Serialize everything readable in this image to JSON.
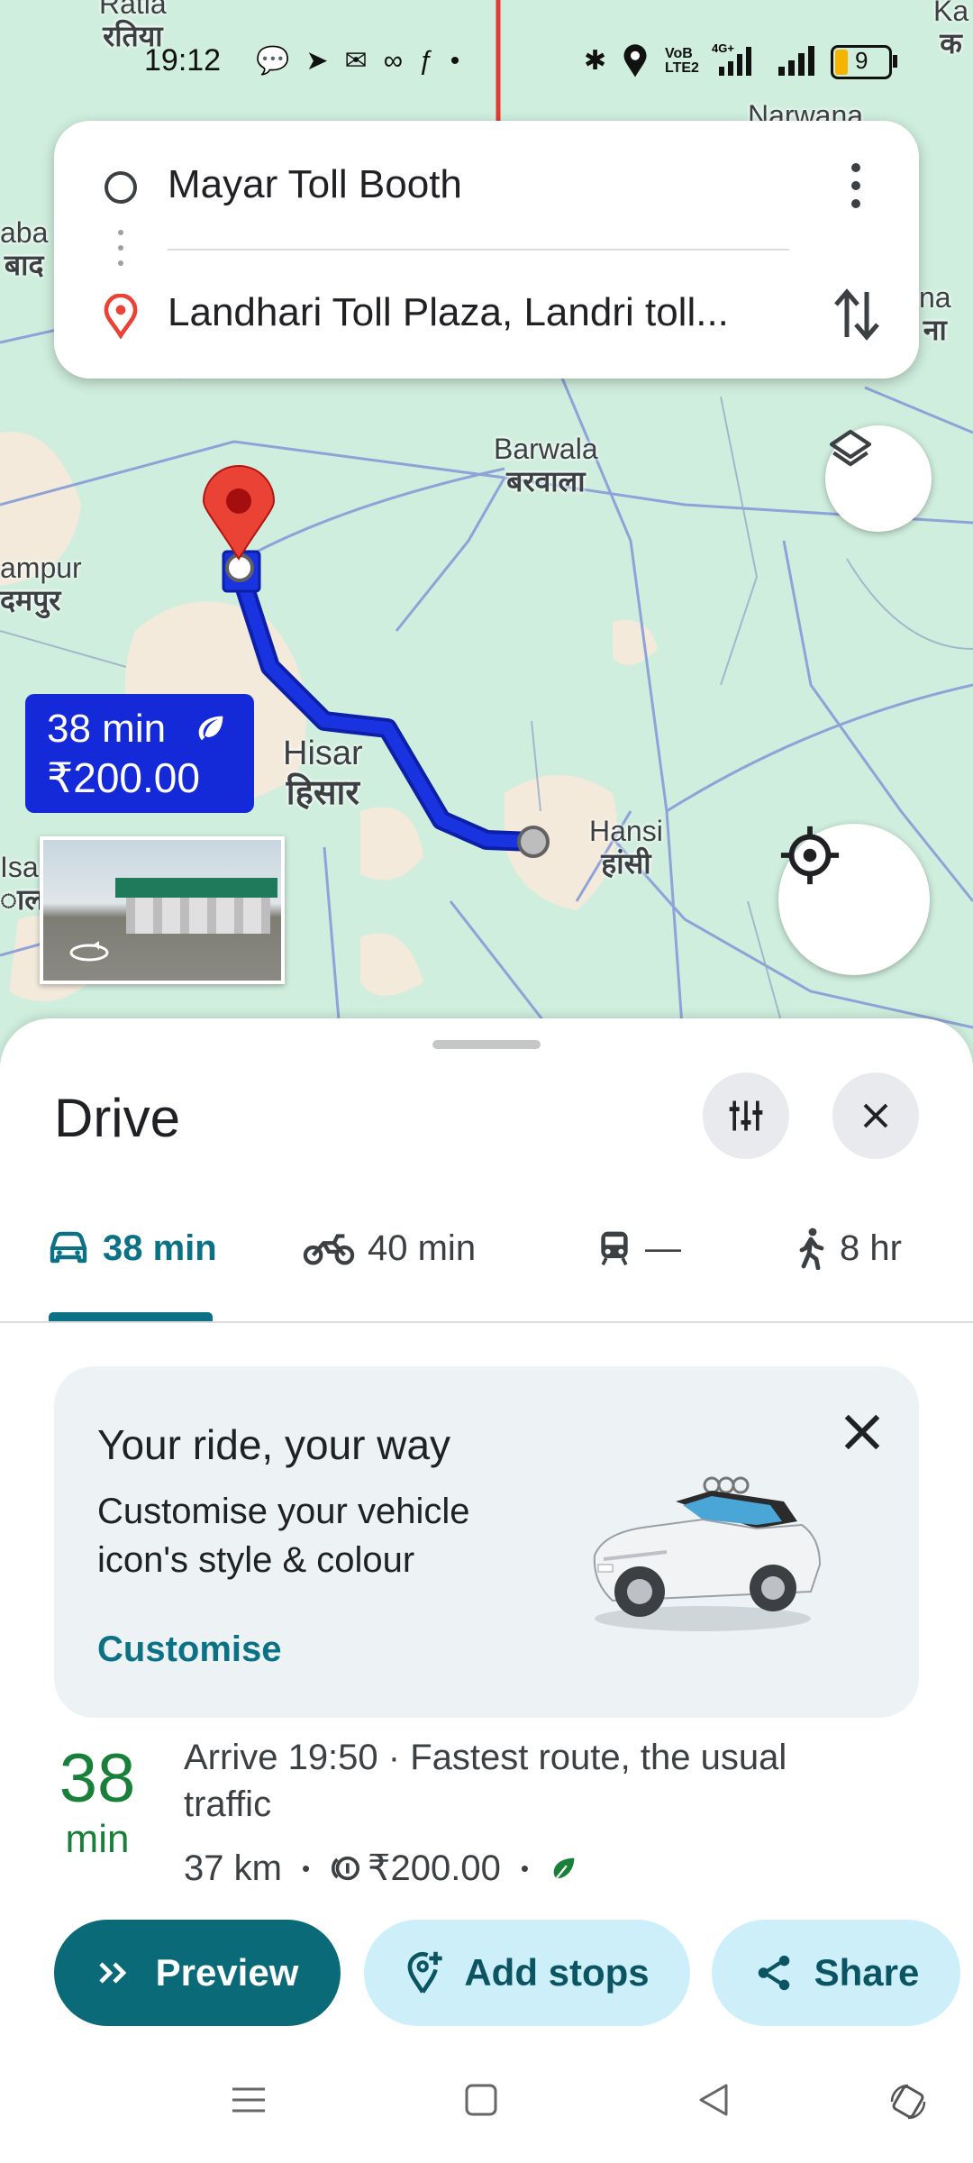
{
  "status_bar": {
    "time": "19:12",
    "battery": "9"
  },
  "search": {
    "origin": "Mayar Toll Booth",
    "destination": "Landhari Toll Plaza, Landri toll..."
  },
  "map": {
    "labels": {
      "ratia_en": "Ratia",
      "ratia_hi": "रतिया",
      "narwana": "Narwana",
      "aba": "aba",
      "aba_hi": "बाद",
      "na_en": "na",
      "na_hi": "ना",
      "barwala_en": "Barwala",
      "barwala_hi": "बरवाला",
      "ampur_en": "ampur",
      "ampur_hi": "दमपुर",
      "hisar_en": "Hisar",
      "hisar_hi": "हिसार",
      "hansi_en": "Hansi",
      "hansi_hi": "हांसी",
      "isa_en": "Isa",
      "isa_hi": "ाल",
      "ka": "Ka",
      "ka_hi": "क"
    },
    "route_callout": {
      "time": "38 min",
      "toll": "₹200.00"
    }
  },
  "sheet": {
    "title": "Drive",
    "tabs": [
      {
        "mode": "car",
        "label": "38 min"
      },
      {
        "mode": "motorbike",
        "label": "40 min"
      },
      {
        "mode": "transit",
        "label": "—"
      },
      {
        "mode": "walk",
        "label": "8 hr"
      }
    ],
    "promo": {
      "title": "Your ride, your way",
      "body": "Customise your vehicle icon's style & colour",
      "link": "Customise"
    },
    "route": {
      "duration_value": "38",
      "duration_unit": "min",
      "summary": "Arrive 19:50 · Fastest route, the usual traffic",
      "distance": "37 km",
      "toll": "₹200.00"
    },
    "actions": {
      "preview": "Preview",
      "add_stops": "Add stops",
      "share": "Share"
    }
  },
  "colors": {
    "accent": "#0b7285",
    "route": "#1a33e0",
    "duration_green": "#188038"
  }
}
